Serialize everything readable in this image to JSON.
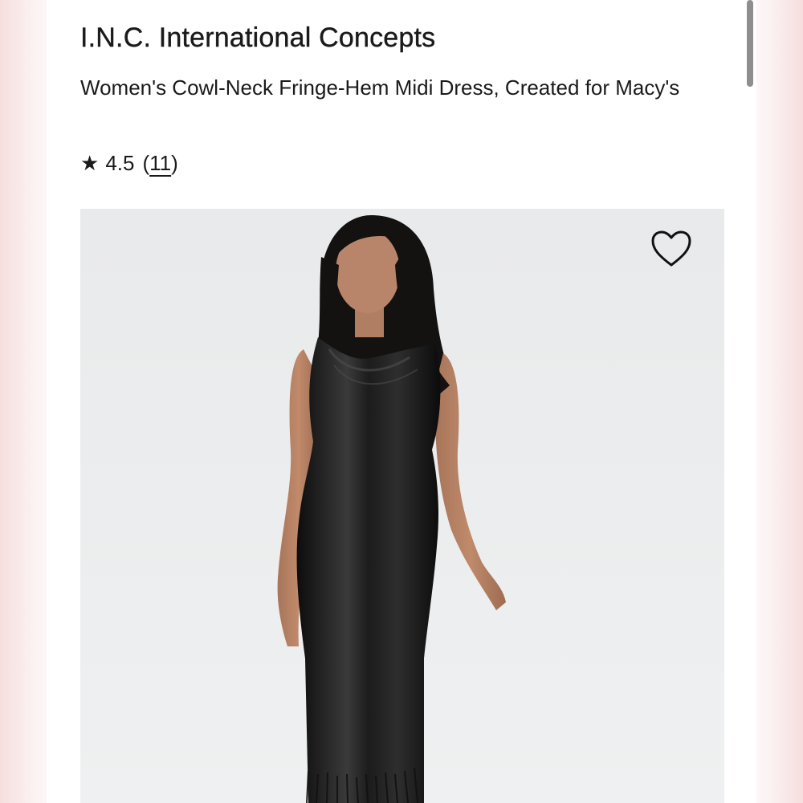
{
  "product": {
    "brand": "I.N.C. International Concepts",
    "name": "Women's Cowl-Neck Fringe-Hem Midi Dress, Created for Macy's",
    "rating": {
      "star_icon": "star-icon",
      "value": "4.5",
      "open_paren": "(",
      "count": "11",
      "close_paren": ")"
    }
  },
  "image": {
    "wishlist_icon": "heart-outline-icon",
    "subject": "model-wearing-black-satin-dress",
    "background_color": "#eaebec",
    "dress_color": "#1a1a1a"
  }
}
